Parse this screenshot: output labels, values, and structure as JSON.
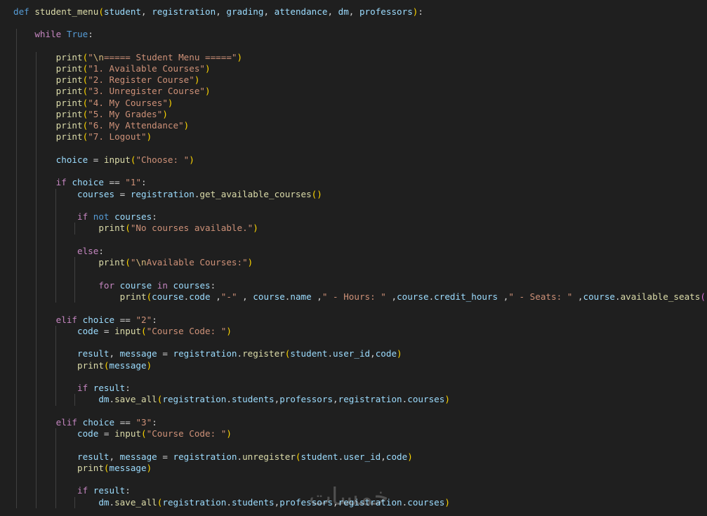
{
  "editor": {
    "language": "python",
    "theme_background": "#1f1f1f"
  },
  "lines": [
    [
      [
        "kw",
        "def"
      ],
      [
        "op",
        " "
      ],
      [
        "fn",
        "student_menu"
      ],
      [
        "p1",
        "("
      ],
      [
        "var",
        "student"
      ],
      [
        "op",
        ", "
      ],
      [
        "var",
        "registration"
      ],
      [
        "op",
        ", "
      ],
      [
        "var",
        "grading"
      ],
      [
        "op",
        ", "
      ],
      [
        "var",
        "attendance"
      ],
      [
        "op",
        ", "
      ],
      [
        "var",
        "dm"
      ],
      [
        "op",
        ", "
      ],
      [
        "var",
        "professors"
      ],
      [
        "p1",
        ")"
      ],
      [
        "op",
        ":"
      ]
    ],
    [],
    [
      [
        "op",
        "    "
      ],
      [
        "ctl",
        "while"
      ],
      [
        "op",
        " "
      ],
      [
        "kw",
        "True"
      ],
      [
        "op",
        ":"
      ]
    ],
    [],
    [
      [
        "op",
        "        "
      ],
      [
        "fn",
        "print"
      ],
      [
        "p1",
        "("
      ],
      [
        "str",
        "\""
      ],
      [
        "esc",
        "\\n"
      ],
      [
        "str",
        "===== Student Menu =====\""
      ],
      [
        "p1",
        ")"
      ]
    ],
    [
      [
        "op",
        "        "
      ],
      [
        "fn",
        "print"
      ],
      [
        "p1",
        "("
      ],
      [
        "str",
        "\"1. Available Courses\""
      ],
      [
        "p1",
        ")"
      ]
    ],
    [
      [
        "op",
        "        "
      ],
      [
        "fn",
        "print"
      ],
      [
        "p1",
        "("
      ],
      [
        "str",
        "\"2. Register Course\""
      ],
      [
        "p1",
        ")"
      ]
    ],
    [
      [
        "op",
        "        "
      ],
      [
        "fn",
        "print"
      ],
      [
        "p1",
        "("
      ],
      [
        "str",
        "\"3. Unregister Course\""
      ],
      [
        "p1",
        ")"
      ]
    ],
    [
      [
        "op",
        "        "
      ],
      [
        "fn",
        "print"
      ],
      [
        "p1",
        "("
      ],
      [
        "str",
        "\"4. My Courses\""
      ],
      [
        "p1",
        ")"
      ]
    ],
    [
      [
        "op",
        "        "
      ],
      [
        "fn",
        "print"
      ],
      [
        "p1",
        "("
      ],
      [
        "str",
        "\"5. My Grades\""
      ],
      [
        "p1",
        ")"
      ]
    ],
    [
      [
        "op",
        "        "
      ],
      [
        "fn",
        "print"
      ],
      [
        "p1",
        "("
      ],
      [
        "str",
        "\"6. My Attendance\""
      ],
      [
        "p1",
        ")"
      ]
    ],
    [
      [
        "op",
        "        "
      ],
      [
        "fn",
        "print"
      ],
      [
        "p1",
        "("
      ],
      [
        "str",
        "\"7. Logout\""
      ],
      [
        "p1",
        ")"
      ]
    ],
    [],
    [
      [
        "op",
        "        "
      ],
      [
        "var",
        "choice"
      ],
      [
        "op",
        " = "
      ],
      [
        "fn",
        "input"
      ],
      [
        "p1",
        "("
      ],
      [
        "str",
        "\"Choose: \""
      ],
      [
        "p1",
        ")"
      ]
    ],
    [],
    [
      [
        "op",
        "        "
      ],
      [
        "ctl",
        "if"
      ],
      [
        "op",
        " "
      ],
      [
        "var",
        "choice"
      ],
      [
        "op",
        " == "
      ],
      [
        "str",
        "\"1\""
      ],
      [
        "op",
        ":"
      ]
    ],
    [
      [
        "op",
        "            "
      ],
      [
        "var",
        "courses"
      ],
      [
        "op",
        " = "
      ],
      [
        "var",
        "registration"
      ],
      [
        "op",
        "."
      ],
      [
        "fn",
        "get_available_courses"
      ],
      [
        "p1",
        "()"
      ]
    ],
    [],
    [
      [
        "op",
        "            "
      ],
      [
        "ctl",
        "if"
      ],
      [
        "op",
        " "
      ],
      [
        "kw",
        "not"
      ],
      [
        "op",
        " "
      ],
      [
        "var",
        "courses"
      ],
      [
        "op",
        ":"
      ]
    ],
    [
      [
        "op",
        "                "
      ],
      [
        "fn",
        "print"
      ],
      [
        "p1",
        "("
      ],
      [
        "str",
        "\"No courses available.\""
      ],
      [
        "p1",
        ")"
      ]
    ],
    [],
    [
      [
        "op",
        "            "
      ],
      [
        "ctl",
        "else"
      ],
      [
        "op",
        ":"
      ]
    ],
    [
      [
        "op",
        "                "
      ],
      [
        "fn",
        "print"
      ],
      [
        "p1",
        "("
      ],
      [
        "str",
        "\""
      ],
      [
        "esc",
        "\\n"
      ],
      [
        "str",
        "Available Courses:\""
      ],
      [
        "p1",
        ")"
      ]
    ],
    [],
    [
      [
        "op",
        "                "
      ],
      [
        "ctl",
        "for"
      ],
      [
        "op",
        " "
      ],
      [
        "var",
        "course"
      ],
      [
        "op",
        " "
      ],
      [
        "ctl",
        "in"
      ],
      [
        "op",
        " "
      ],
      [
        "var",
        "courses"
      ],
      [
        "op",
        ":"
      ]
    ],
    [
      [
        "op",
        "                    "
      ],
      [
        "fn",
        "print"
      ],
      [
        "p1",
        "("
      ],
      [
        "var",
        "course"
      ],
      [
        "op",
        "."
      ],
      [
        "var",
        "code"
      ],
      [
        "op",
        " ,"
      ],
      [
        "str",
        "\"-\""
      ],
      [
        "op",
        " , "
      ],
      [
        "var",
        "course"
      ],
      [
        "op",
        "."
      ],
      [
        "var",
        "name"
      ],
      [
        "op",
        " ,"
      ],
      [
        "str",
        "\" - Hours: \""
      ],
      [
        "op",
        " ,"
      ],
      [
        "var",
        "course"
      ],
      [
        "op",
        "."
      ],
      [
        "var",
        "credit_hours"
      ],
      [
        "op",
        " ,"
      ],
      [
        "str",
        "\" - Seats: \""
      ],
      [
        "op",
        " ,"
      ],
      [
        "var",
        "course"
      ],
      [
        "op",
        "."
      ],
      [
        "fn",
        "available_seats"
      ],
      [
        "p2",
        "()"
      ],
      [
        "p1",
        ")"
      ]
    ],
    [],
    [
      [
        "op",
        "        "
      ],
      [
        "ctl",
        "elif"
      ],
      [
        "op",
        " "
      ],
      [
        "var",
        "choice"
      ],
      [
        "op",
        " == "
      ],
      [
        "str",
        "\"2\""
      ],
      [
        "op",
        ":"
      ]
    ],
    [
      [
        "op",
        "            "
      ],
      [
        "var",
        "code"
      ],
      [
        "op",
        " = "
      ],
      [
        "fn",
        "input"
      ],
      [
        "p1",
        "("
      ],
      [
        "str",
        "\"Course Code: \""
      ],
      [
        "p1",
        ")"
      ]
    ],
    [],
    [
      [
        "op",
        "            "
      ],
      [
        "var",
        "result"
      ],
      [
        "op",
        ", "
      ],
      [
        "var",
        "message"
      ],
      [
        "op",
        " = "
      ],
      [
        "var",
        "registration"
      ],
      [
        "op",
        "."
      ],
      [
        "fn",
        "register"
      ],
      [
        "p1",
        "("
      ],
      [
        "var",
        "student"
      ],
      [
        "op",
        "."
      ],
      [
        "var",
        "user_id"
      ],
      [
        "op",
        ","
      ],
      [
        "var",
        "code"
      ],
      [
        "p1",
        ")"
      ]
    ],
    [
      [
        "op",
        "            "
      ],
      [
        "fn",
        "print"
      ],
      [
        "p1",
        "("
      ],
      [
        "var",
        "message"
      ],
      [
        "p1",
        ")"
      ]
    ],
    [],
    [
      [
        "op",
        "            "
      ],
      [
        "ctl",
        "if"
      ],
      [
        "op",
        " "
      ],
      [
        "var",
        "result"
      ],
      [
        "op",
        ":"
      ]
    ],
    [
      [
        "op",
        "                "
      ],
      [
        "var",
        "dm"
      ],
      [
        "op",
        "."
      ],
      [
        "fn",
        "save_all"
      ],
      [
        "p1",
        "("
      ],
      [
        "var",
        "registration"
      ],
      [
        "op",
        "."
      ],
      [
        "var",
        "students"
      ],
      [
        "op",
        ","
      ],
      [
        "var",
        "professors"
      ],
      [
        "op",
        ","
      ],
      [
        "var",
        "registration"
      ],
      [
        "op",
        "."
      ],
      [
        "var",
        "courses"
      ],
      [
        "p1",
        ")"
      ]
    ],
    [],
    [
      [
        "op",
        "        "
      ],
      [
        "ctl",
        "elif"
      ],
      [
        "op",
        " "
      ],
      [
        "var",
        "choice"
      ],
      [
        "op",
        " == "
      ],
      [
        "str",
        "\"3\""
      ],
      [
        "op",
        ":"
      ]
    ],
    [
      [
        "op",
        "            "
      ],
      [
        "var",
        "code"
      ],
      [
        "op",
        " = "
      ],
      [
        "fn",
        "input"
      ],
      [
        "p1",
        "("
      ],
      [
        "str",
        "\"Course Code: \""
      ],
      [
        "p1",
        ")"
      ]
    ],
    [],
    [
      [
        "op",
        "            "
      ],
      [
        "var",
        "result"
      ],
      [
        "op",
        ", "
      ],
      [
        "var",
        "message"
      ],
      [
        "op",
        " = "
      ],
      [
        "var",
        "registration"
      ],
      [
        "op",
        "."
      ],
      [
        "fn",
        "unregister"
      ],
      [
        "p1",
        "("
      ],
      [
        "var",
        "student"
      ],
      [
        "op",
        "."
      ],
      [
        "var",
        "user_id"
      ],
      [
        "op",
        ","
      ],
      [
        "var",
        "code"
      ],
      [
        "p1",
        ")"
      ]
    ],
    [
      [
        "op",
        "            "
      ],
      [
        "fn",
        "print"
      ],
      [
        "p1",
        "("
      ],
      [
        "var",
        "message"
      ],
      [
        "p1",
        ")"
      ]
    ],
    [],
    [
      [
        "op",
        "            "
      ],
      [
        "ctl",
        "if"
      ],
      [
        "op",
        " "
      ],
      [
        "var",
        "result"
      ],
      [
        "op",
        ":"
      ]
    ],
    [
      [
        "op",
        "                "
      ],
      [
        "var",
        "dm"
      ],
      [
        "op",
        "."
      ],
      [
        "fn",
        "save_all"
      ],
      [
        "p1",
        "("
      ],
      [
        "var",
        "registration"
      ],
      [
        "op",
        "."
      ],
      [
        "var",
        "students"
      ],
      [
        "op",
        ","
      ],
      [
        "var",
        "professors"
      ],
      [
        "op",
        ","
      ],
      [
        "var",
        "registration"
      ],
      [
        "op",
        "."
      ],
      [
        "var",
        "courses"
      ],
      [
        "p1",
        ")"
      ]
    ]
  ],
  "watermark": "خمسات"
}
